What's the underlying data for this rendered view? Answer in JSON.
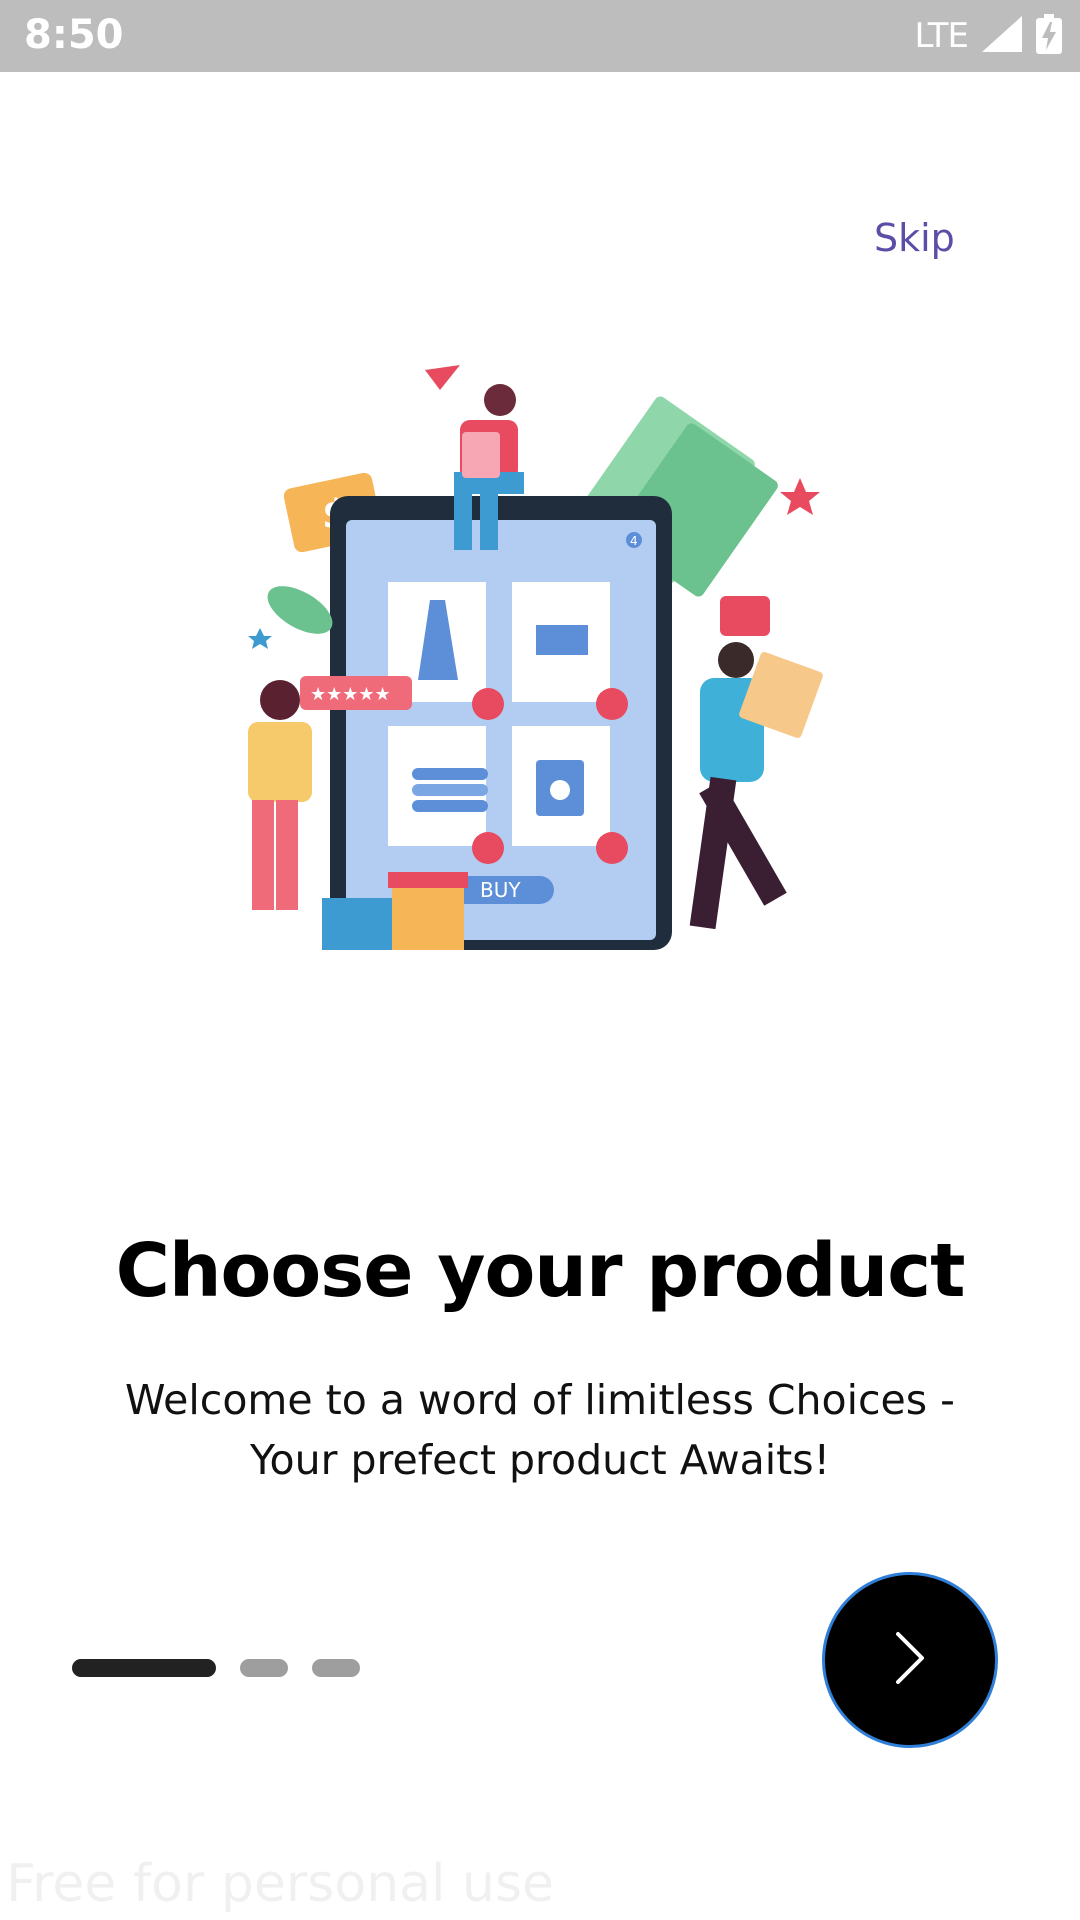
{
  "status_bar": {
    "time": "8:50",
    "network": "LTE"
  },
  "onboarding": {
    "skip_label": "Skip",
    "title": "Choose your product",
    "subtitle_line1": "Welcome to a word of limitless Choices -",
    "subtitle_line2": "Your prefect product Awaits!",
    "illustration_buy_label": "BUY",
    "cart_badge_count": "4",
    "current_page": 1,
    "total_pages": 3
  },
  "watermark": "Free for personal use",
  "colors": {
    "accent_text": "#5b4ea6",
    "next_button_bg": "#000000",
    "next_button_border": "#2f7fd8",
    "dot_active": "#222222",
    "dot_inactive": "#9e9e9e"
  },
  "icons": {
    "signal": "signal-icon",
    "battery": "battery-charging-icon",
    "next": "chevron-right-icon"
  }
}
